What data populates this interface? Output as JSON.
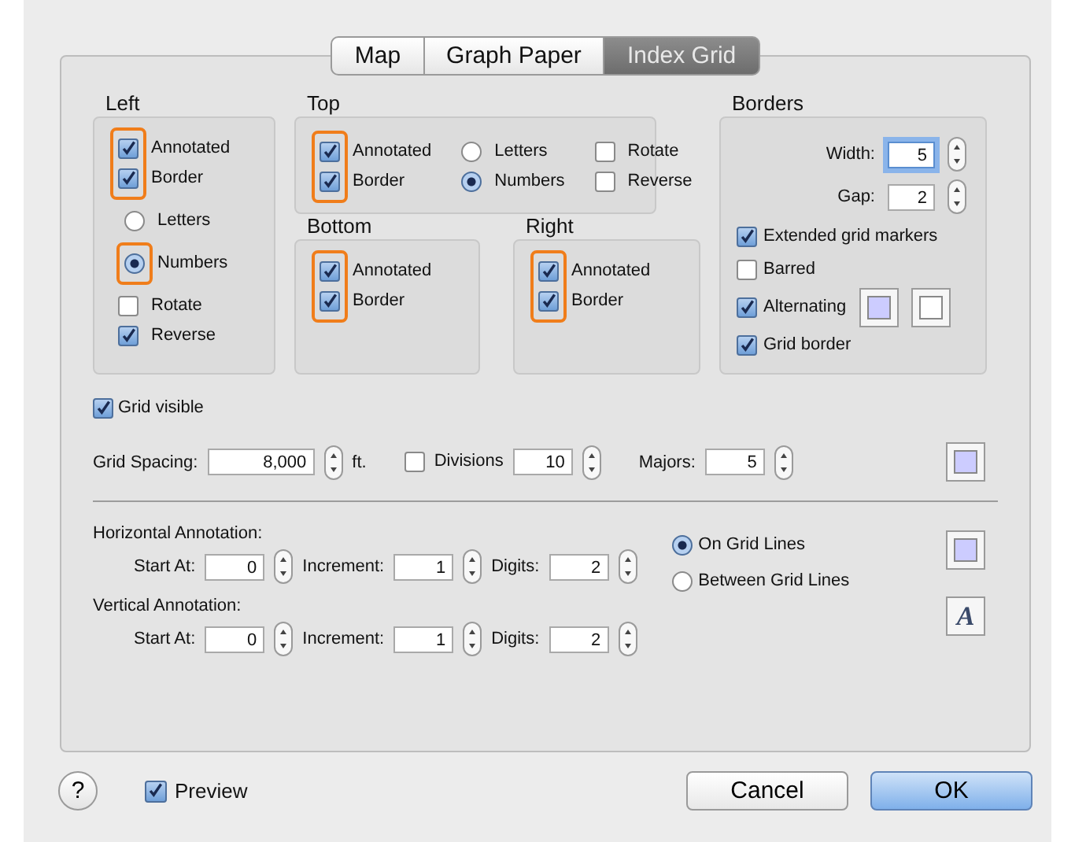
{
  "tabs": [
    {
      "label": "Map",
      "selected": false
    },
    {
      "label": "Graph Paper",
      "selected": false
    },
    {
      "label": "Index Grid",
      "selected": true
    }
  ],
  "groups": [
    {
      "title": "Left",
      "kind": "stacked",
      "sections": [
        {
          "kind": "check",
          "highlighted": true,
          "items": [
            {
              "label": "Annotated",
              "checked": true
            },
            {
              "label": "Border",
              "checked": true
            }
          ]
        },
        {
          "kind": "radio",
          "highlighted": false,
          "items": [
            {
              "label": "Letters",
              "selected": false
            }
          ]
        },
        {
          "kind": "radio",
          "highlighted": true,
          "items": [
            {
              "label": "Numbers",
              "selected": true
            }
          ]
        },
        {
          "kind": "check",
          "highlighted": false,
          "items": [
            {
              "label": "Rotate",
              "checked": false
            },
            {
              "label": "Reverse",
              "checked": true
            }
          ]
        }
      ]
    },
    {
      "title": "Top",
      "kind": "row",
      "sections": [
        {
          "kind": "check",
          "highlighted": true,
          "items": [
            {
              "label": "Annotated",
              "checked": true
            },
            {
              "label": "Border",
              "checked": true
            }
          ]
        },
        {
          "kind": "radio",
          "highlighted": false,
          "items": [
            {
              "label": "Letters",
              "selected": false
            },
            {
              "label": "Numbers",
              "selected": true
            }
          ]
        },
        {
          "kind": "check",
          "highlighted": false,
          "items": [
            {
              "label": "Rotate",
              "checked": false
            },
            {
              "label": "Reverse",
              "checked": false
            }
          ]
        }
      ]
    },
    {
      "title": "Bottom",
      "kind": "stacked",
      "sections": [
        {
          "kind": "check",
          "highlighted": true,
          "items": [
            {
              "label": "Annotated",
              "checked": true
            },
            {
              "label": "Border",
              "checked": true
            }
          ]
        }
      ]
    },
    {
      "title": "Right",
      "kind": "stacked",
      "sections": [
        {
          "kind": "check",
          "highlighted": true,
          "items": [
            {
              "label": "Annotated",
              "checked": true
            },
            {
              "label": "Border",
              "checked": true
            }
          ]
        }
      ]
    }
  ],
  "borders": {
    "title": "Borders",
    "fields": [
      {
        "label": "Width:",
        "value": "5",
        "focused": true
      },
      {
        "label": "Gap:",
        "value": "2",
        "focused": false
      }
    ],
    "checks": [
      {
        "label": "Extended grid markers",
        "checked": true
      },
      {
        "label": "Barred",
        "checked": false
      },
      {
        "label": "Alternating",
        "checked": true,
        "swatches": [
          {
            "color": "#ccccff"
          },
          {
            "color": "#ffffff"
          }
        ]
      },
      {
        "label": "Grid border",
        "checked": true
      }
    ]
  },
  "grid_visible": {
    "label": "Grid visible",
    "checked": true
  },
  "spacing": {
    "label": "Grid Spacing:",
    "value": "8,000",
    "unit": "ft.",
    "divisions": {
      "label": "Divisions",
      "checked": false,
      "value": "10"
    },
    "majors": {
      "label": "Majors:",
      "value": "5"
    },
    "color": "#ccccff"
  },
  "annotations": [
    {
      "title": "Horizontal Annotation:",
      "fields": [
        {
          "label": "Start At:",
          "value": "0"
        },
        {
          "label": "Increment:",
          "value": "1"
        },
        {
          "label": "Digits:",
          "value": "2"
        }
      ]
    },
    {
      "title": "Vertical Annotation:",
      "fields": [
        {
          "label": "Start At:",
          "value": "0"
        },
        {
          "label": "Increment:",
          "value": "1"
        },
        {
          "label": "Digits:",
          "value": "2"
        }
      ]
    }
  ],
  "placement": [
    {
      "label": "On Grid Lines",
      "selected": true
    },
    {
      "label": "Between Grid Lines",
      "selected": false
    }
  ],
  "annotation_well": {
    "color": "#ccccff"
  },
  "font_button": "A",
  "help": "?",
  "preview": {
    "label": "Preview",
    "checked": true
  },
  "buttons": [
    {
      "label": "Cancel",
      "kind": "normal"
    },
    {
      "label": "OK",
      "kind": "default"
    }
  ]
}
